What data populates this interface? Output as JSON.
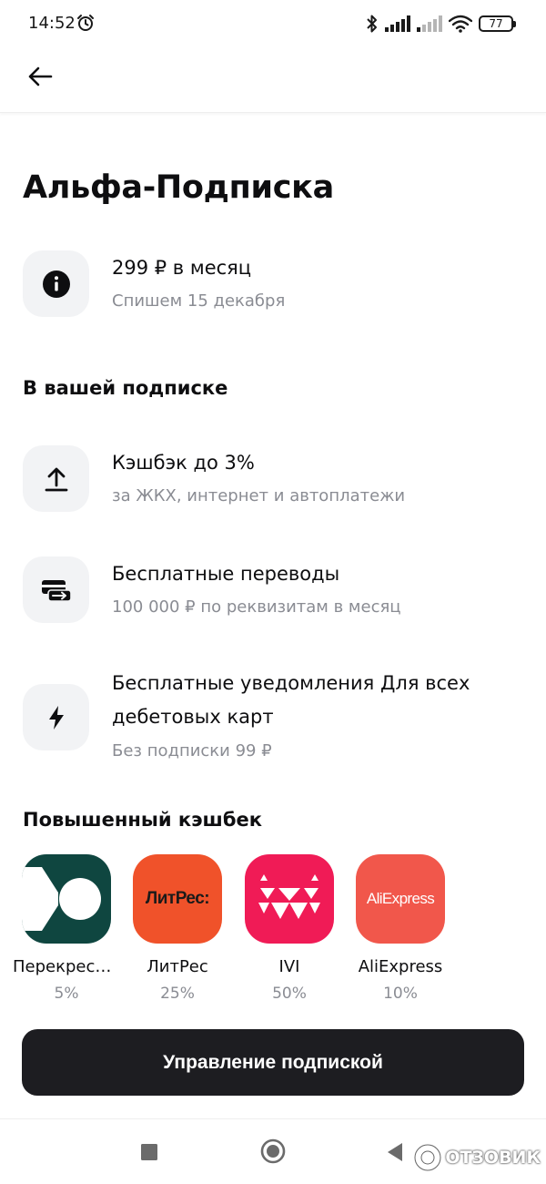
{
  "status_bar": {
    "time": "14:52",
    "battery": "77"
  },
  "page": {
    "title": "Альфа-Подписка"
  },
  "price": {
    "title": "299 ₽ в месяц",
    "subtitle": "Спишем 15 декабря",
    "icon": "info-icon"
  },
  "benefits_section": {
    "title": "В вашей подписке",
    "items": [
      {
        "title": "Кэшбэк до 3%",
        "subtitle": "за ЖКХ, интернет и автоплатежи",
        "icon": "upload-icon"
      },
      {
        "title": "Бесплатные переводы",
        "subtitle": "100 000 ₽ по реквизитам в месяц",
        "icon": "transfer-icon"
      },
      {
        "title": "Бесплатные уведомления Для всех дебетовых карт",
        "subtitle": "Без подписки 99 ₽",
        "icon": "lightning-icon"
      }
    ]
  },
  "cashback_section": {
    "title": "Повышенный кэшбек",
    "partners": [
      {
        "name": "Перекресток",
        "percent": "5%",
        "color": "#0f4640"
      },
      {
        "name": "ЛитРес",
        "percent": "25%",
        "color": "#f0522a",
        "logo_text": "ЛитРес:"
      },
      {
        "name": "IVI",
        "percent": "50%",
        "color": "#f01b56"
      },
      {
        "name": "AliExpress",
        "percent": "10%",
        "color": "#f1574b",
        "logo_text": "AliExpress"
      }
    ]
  },
  "manage_button": {
    "label": "Управление подпиской"
  },
  "watermark": {
    "text": "ОТЗОВИК"
  },
  "colors": {
    "tile_bg": "#f2f3f5",
    "primary_text": "#0e0e10",
    "secondary_text": "#8a8c93",
    "button_bg": "#1d1d21"
  }
}
